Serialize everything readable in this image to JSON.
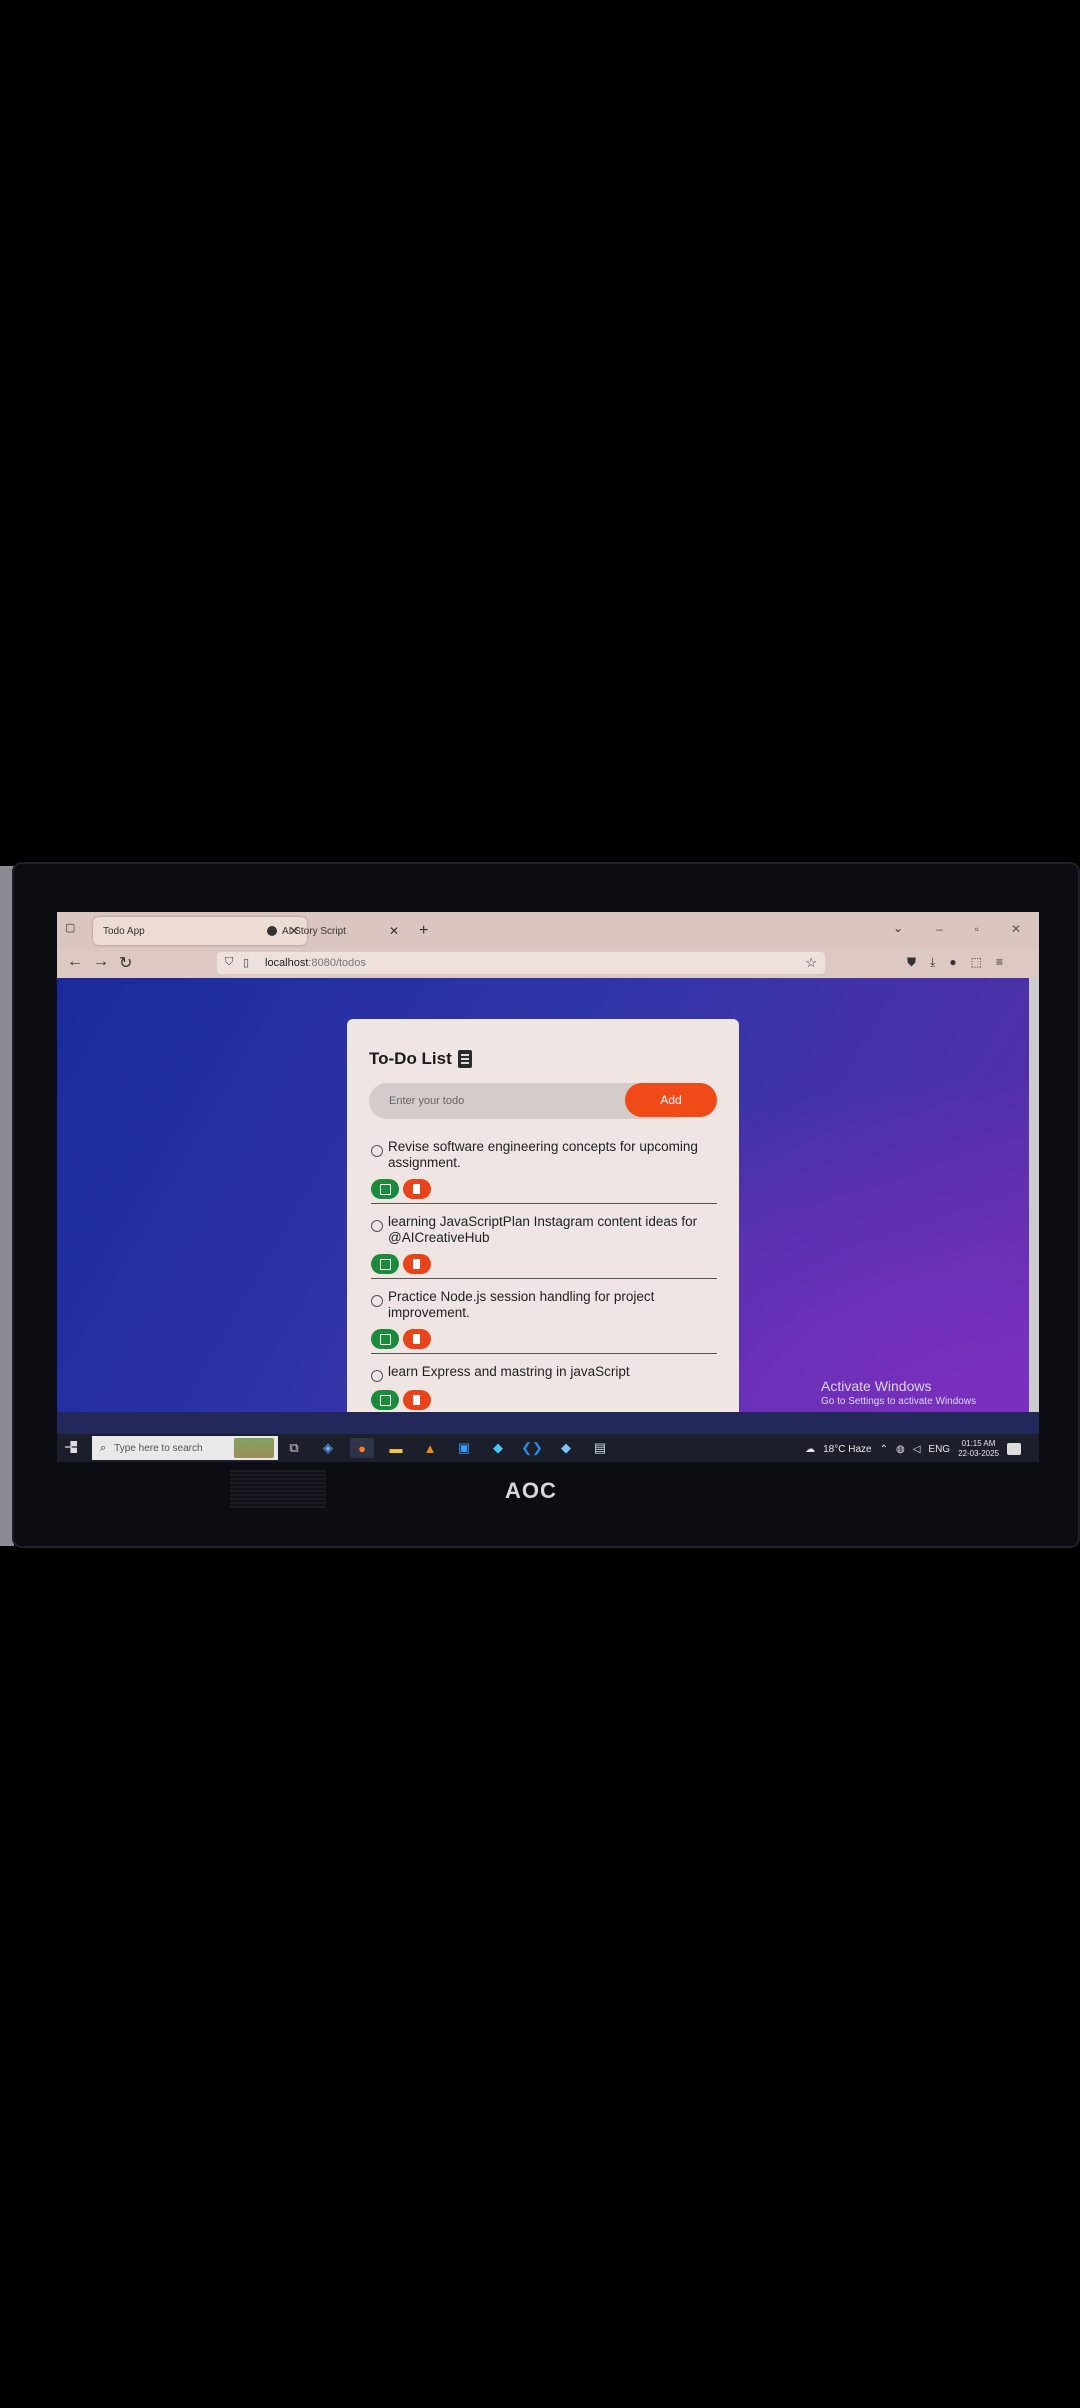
{
  "browser": {
    "tabs": [
      {
        "label": "Todo App",
        "active": true
      },
      {
        "label": "AI Story Script",
        "active": false
      }
    ],
    "url": {
      "host": "localhost",
      "path": ":8080/todos"
    }
  },
  "app": {
    "title": "To-Do List",
    "input": {
      "placeholder": "Enter your todo"
    },
    "add_label": "Add",
    "todos": [
      {
        "text": "Revise software engineering concepts for upcoming assignment."
      },
      {
        "text": "learning JavaScriptPlan Instagram content ideas for @AICreativeHub"
      },
      {
        "text": "Practice Node.js session handling for project improvement."
      },
      {
        "text": "learn Express and mastring in javaScript"
      }
    ]
  },
  "watermark": {
    "title": "Activate Windows",
    "subtitle": "Go to Settings to activate Windows"
  },
  "taskbar": {
    "search_placeholder": "Type here to search",
    "weather": "18°C  Haze",
    "language": "ENG",
    "time": "01:15 AM",
    "date": "22-03-2025"
  },
  "monitor": {
    "brand": "AOC"
  }
}
